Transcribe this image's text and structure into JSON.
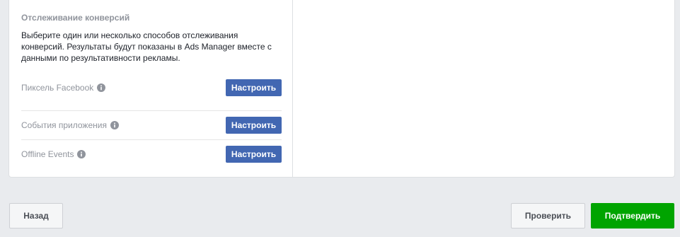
{
  "conversion_tracking": {
    "title": "Отслеживание конверсий",
    "description": "Выберите один или несколько способов отслеживания конверсий. Результаты будут показаны в Ads Manager вместе с данными по результативности рекламы.",
    "rows": [
      {
        "label": "Пиксель Facebook",
        "icon": "info-icon",
        "button_label": "Настроить"
      },
      {
        "label": "События приложения",
        "icon": "info-icon",
        "button_label": "Настроить"
      },
      {
        "label": "Offline Events",
        "icon": "info-icon",
        "button_label": "Настроить"
      }
    ]
  },
  "footer": {
    "back_label": "Назад",
    "check_label": "Проверить",
    "confirm_label": "Подтвердить"
  },
  "colors": {
    "primary_button": "#4267b2",
    "confirm_button": "#00a400",
    "page_background": "#e9ebee"
  }
}
